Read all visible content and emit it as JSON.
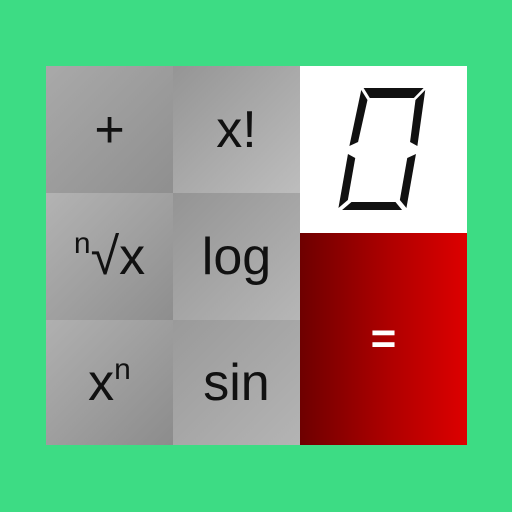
{
  "keys": {
    "plus": "+",
    "factorial": "x!",
    "nth_root": {
      "index": "n",
      "radical": "√x"
    },
    "log": "log",
    "power": {
      "base": "x",
      "exponent": "n"
    },
    "sin": "sin",
    "equals": "="
  },
  "display": {
    "value": "0"
  },
  "colors": {
    "background": "#3ddc84",
    "display_bg": "#ffffff",
    "equals_dark": "#6e0000",
    "equals_bright": "#dd0000",
    "key_gray": "#a0a0a0"
  }
}
